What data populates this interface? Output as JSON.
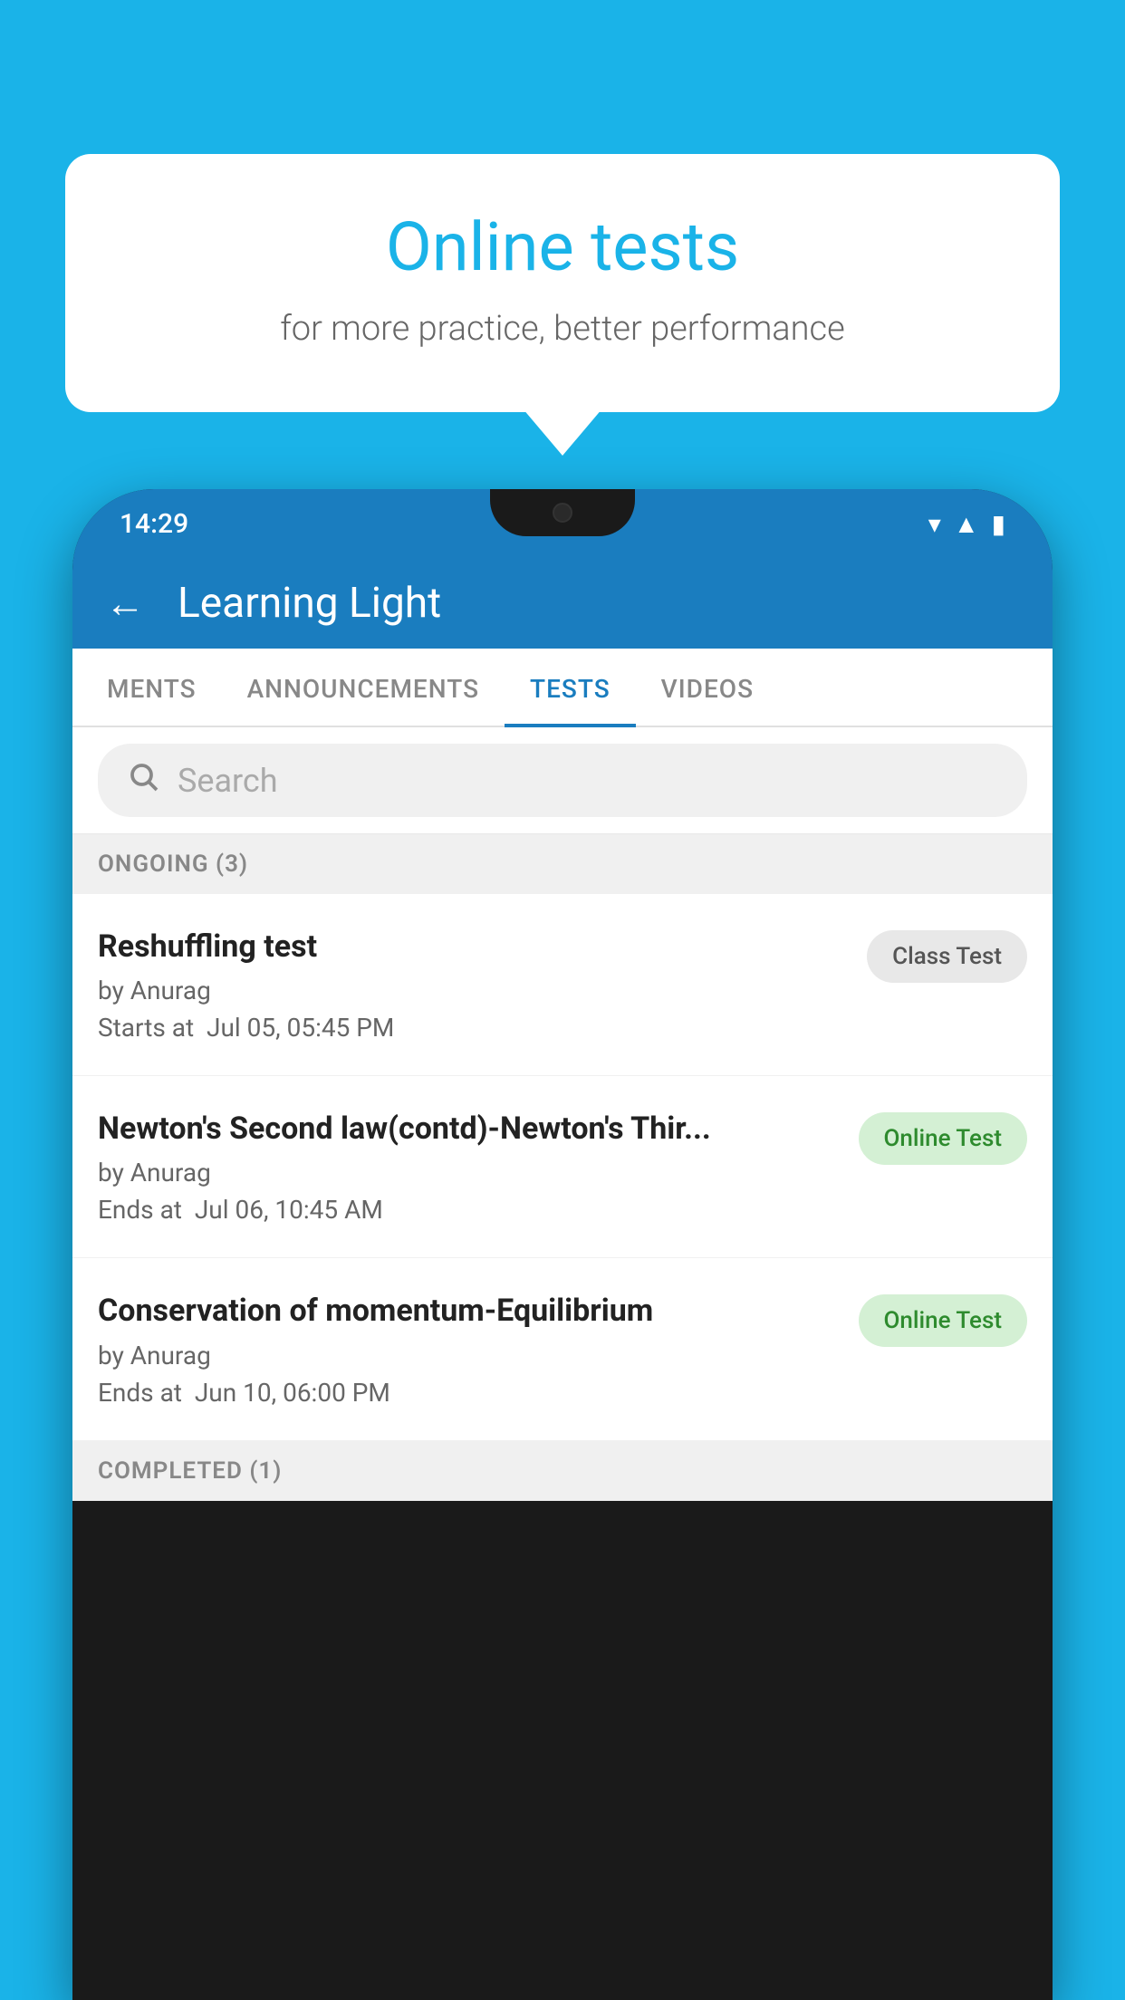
{
  "background_color": "#1ab3e8",
  "promo": {
    "title": "Online tests",
    "subtitle": "for more practice, better performance"
  },
  "phone": {
    "status_bar": {
      "time": "14:29",
      "wifi": "▼",
      "signal": "▲",
      "battery": "█"
    },
    "app_bar": {
      "back_label": "←",
      "title": "Learning Light"
    },
    "tabs": [
      {
        "label": "MENTS",
        "active": false
      },
      {
        "label": "ANNOUNCEMENTS",
        "active": false
      },
      {
        "label": "TESTS",
        "active": true
      },
      {
        "label": "VIDEOS",
        "active": false
      }
    ],
    "search": {
      "placeholder": "Search"
    },
    "section_ongoing": {
      "label": "ONGOING (3)"
    },
    "tests": [
      {
        "name": "Reshuffling test",
        "author": "by Anurag",
        "date_label": "Starts at",
        "date": "Jul 05, 05:45 PM",
        "badge": "Class Test",
        "badge_type": "class"
      },
      {
        "name": "Newton's Second law(contd)-Newton's Thir...",
        "author": "by Anurag",
        "date_label": "Ends at",
        "date": "Jul 06, 10:45 AM",
        "badge": "Online Test",
        "badge_type": "online"
      },
      {
        "name": "Conservation of momentum-Equilibrium",
        "author": "by Anurag",
        "date_label": "Ends at",
        "date": "Jun 10, 06:00 PM",
        "badge": "Online Test",
        "badge_type": "online"
      }
    ],
    "section_completed": {
      "label": "COMPLETED (1)"
    }
  }
}
